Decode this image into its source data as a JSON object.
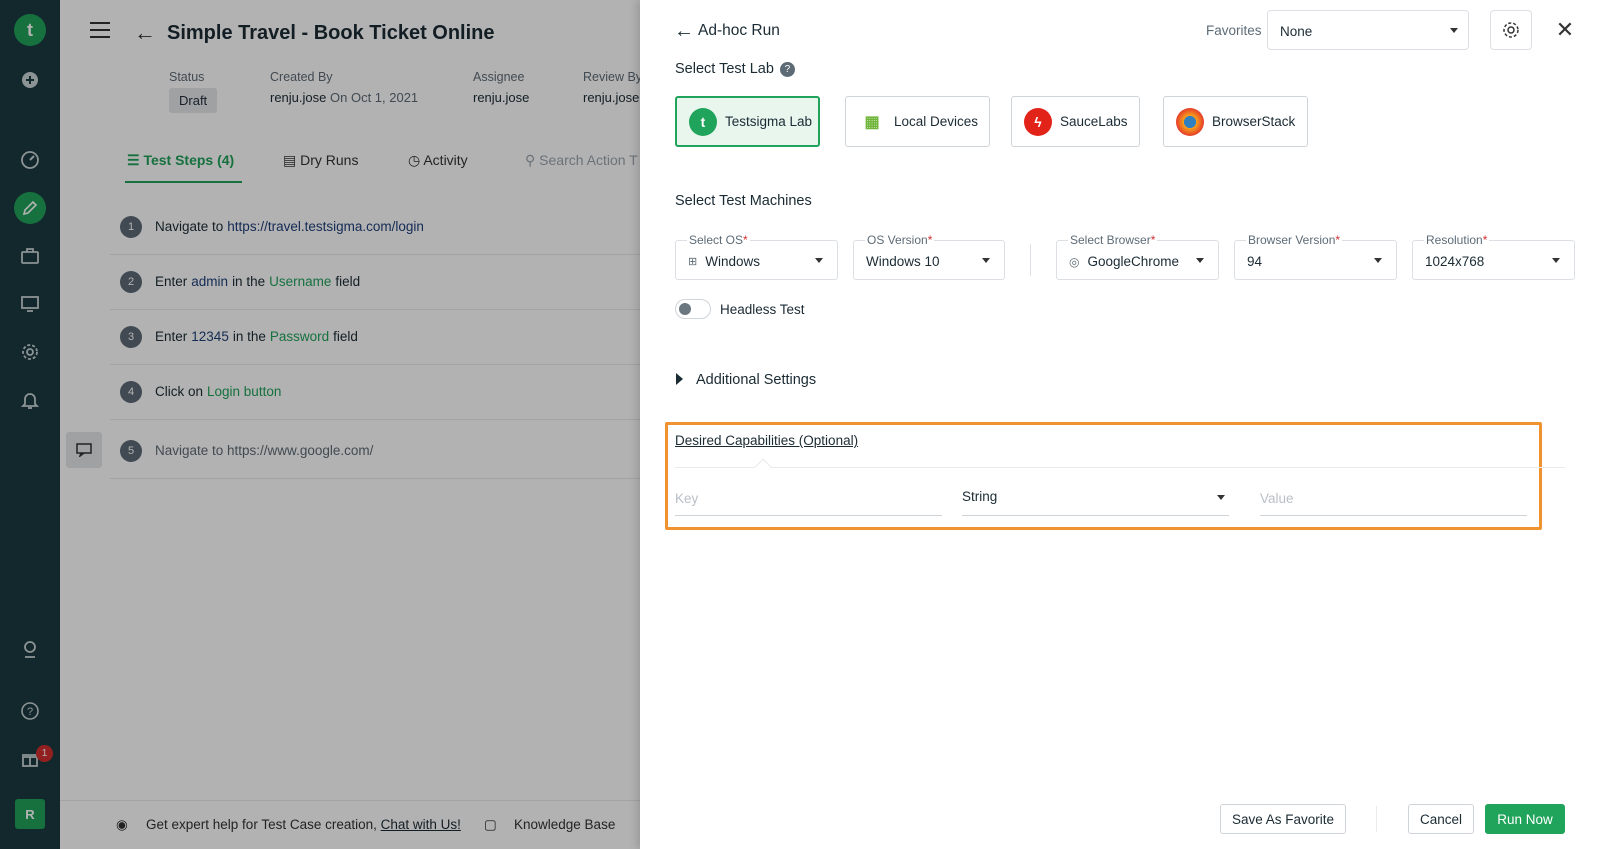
{
  "app": {
    "title": "Simple Travel - Book Ticket Online",
    "user_initial": "R",
    "gift_badge": "1"
  },
  "meta": {
    "status_label": "Status",
    "status_value": "Draft",
    "created_by_label": "Created By",
    "created_by_user": "renju.jose",
    "created_on": "On Oct 1, 2021",
    "assignee_label": "Assignee",
    "assignee_value": "renju.jose",
    "review_by_label": "Review By",
    "review_by_value": "renju.jose"
  },
  "tabs": {
    "test_steps": "Test Steps (4)",
    "dry_runs": "Dry Runs",
    "activity": "Activity",
    "search_placeholder": "Search Action T"
  },
  "steps": [
    {
      "num": "1",
      "action": "Navigate to",
      "value": "https://travel.testsigma.com/login"
    },
    {
      "num": "2",
      "action": "Enter",
      "value": "admin",
      "mid": "in the",
      "element": "Username",
      "suffix": "field"
    },
    {
      "num": "3",
      "action": "Enter",
      "value": "12345",
      "mid": "in the",
      "element": "Password",
      "suffix": "field"
    },
    {
      "num": "4",
      "action": "Click on",
      "element": "Login button"
    },
    {
      "num": "5",
      "text": "Navigate to https://www.google.com/"
    }
  ],
  "footer": {
    "help_text": "Get expert help for Test Case creation,",
    "chat_link": "Chat with Us!",
    "knowledge_base": "Knowledge Base"
  },
  "drawer": {
    "title": "Ad-hoc Run",
    "favorites_label": "Favorites",
    "favorites_value": "None",
    "select_lab_title": "Select Test Lab",
    "labs": [
      {
        "label": "Testsigma Lab",
        "active": true
      },
      {
        "label": "Local Devices",
        "active": false
      },
      {
        "label": "SauceLabs",
        "active": false
      },
      {
        "label": "BrowserStack",
        "active": false
      }
    ],
    "machines_title": "Select Test Machines",
    "fields": {
      "os_label": "Select OS",
      "os_value": "Windows",
      "os_version_label": "OS Version",
      "os_version_value": "Windows 10",
      "browser_label": "Select Browser",
      "browser_value": "GoogleChrome",
      "browser_version_label": "Browser Version",
      "browser_version_value": "94",
      "resolution_label": "Resolution",
      "resolution_value": "1024x768",
      "required_mark": "*"
    },
    "headless_label": "Headless Test",
    "additional_settings": "Additional Settings",
    "capabilities": {
      "title": "Desired Capabilities (Optional)",
      "key_placeholder": "Key",
      "type_value": "String",
      "value_placeholder": "Value"
    },
    "buttons": {
      "save_favorite": "Save As Favorite",
      "cancel": "Cancel",
      "run_now": "Run Now"
    }
  },
  "colors": {
    "brand_green": "#20a35b",
    "nav_bg": "#1b3a3f",
    "highlight_orange": "#f0922f"
  }
}
